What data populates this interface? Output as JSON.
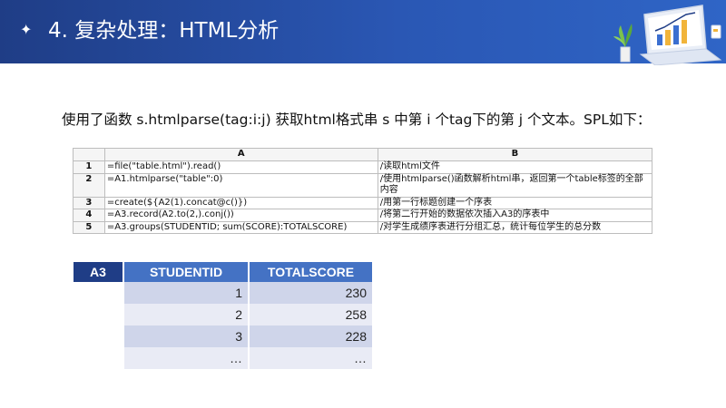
{
  "header": {
    "bullet": "✦",
    "title": "4. 复杂处理：HTML分析"
  },
  "description": "使用了函数 s.htmlparse(tag:i:j) 获取html格式串 s 中第 i 个tag下的第 j 个文本。SPL如下：",
  "code_table": {
    "columns": [
      "",
      "A",
      "B"
    ],
    "rows": [
      {
        "num": "1",
        "a": "=file(\"table.html\").read()",
        "b": "/读取html文件"
      },
      {
        "num": "2",
        "a": "=A1.htmlparse(\"table\":0)",
        "b": "/使用htmlparse()函数解析html串，返回第一个table标签的全部内容"
      },
      {
        "num": "3",
        "a": "=create(${A2(1).concat@c()})",
        "b": "/用第一行标题创建一个序表"
      },
      {
        "num": "4",
        "a": "=A3.record(A2.to(2,).conj())",
        "b": "/将第二行开始的数据依次插入A3的序表中"
      },
      {
        "num": "5",
        "a": "=A3.groups(STUDENTID; sum(SCORE):TOTALSCORE)",
        "b": "/对学生成绩序表进行分组汇总，统计每位学生的总分数"
      }
    ]
  },
  "result_table": {
    "corner": "A3",
    "headers": [
      "STUDENTID",
      "TOTALSCORE"
    ],
    "rows": [
      [
        "1",
        "230"
      ],
      [
        "2",
        "258"
      ],
      [
        "3",
        "228"
      ],
      [
        "…",
        "…"
      ]
    ]
  },
  "colors": {
    "header_dark": "#1f3d86",
    "header_light": "#2f65c6",
    "table_header": "#4472c4",
    "row_dark": "#cfd5ea",
    "row_light": "#e9ebf5"
  },
  "icons": [
    "star-bullet-icon",
    "laptop-chart-illustration",
    "plant-icon",
    "coffee-cup-icon"
  ]
}
